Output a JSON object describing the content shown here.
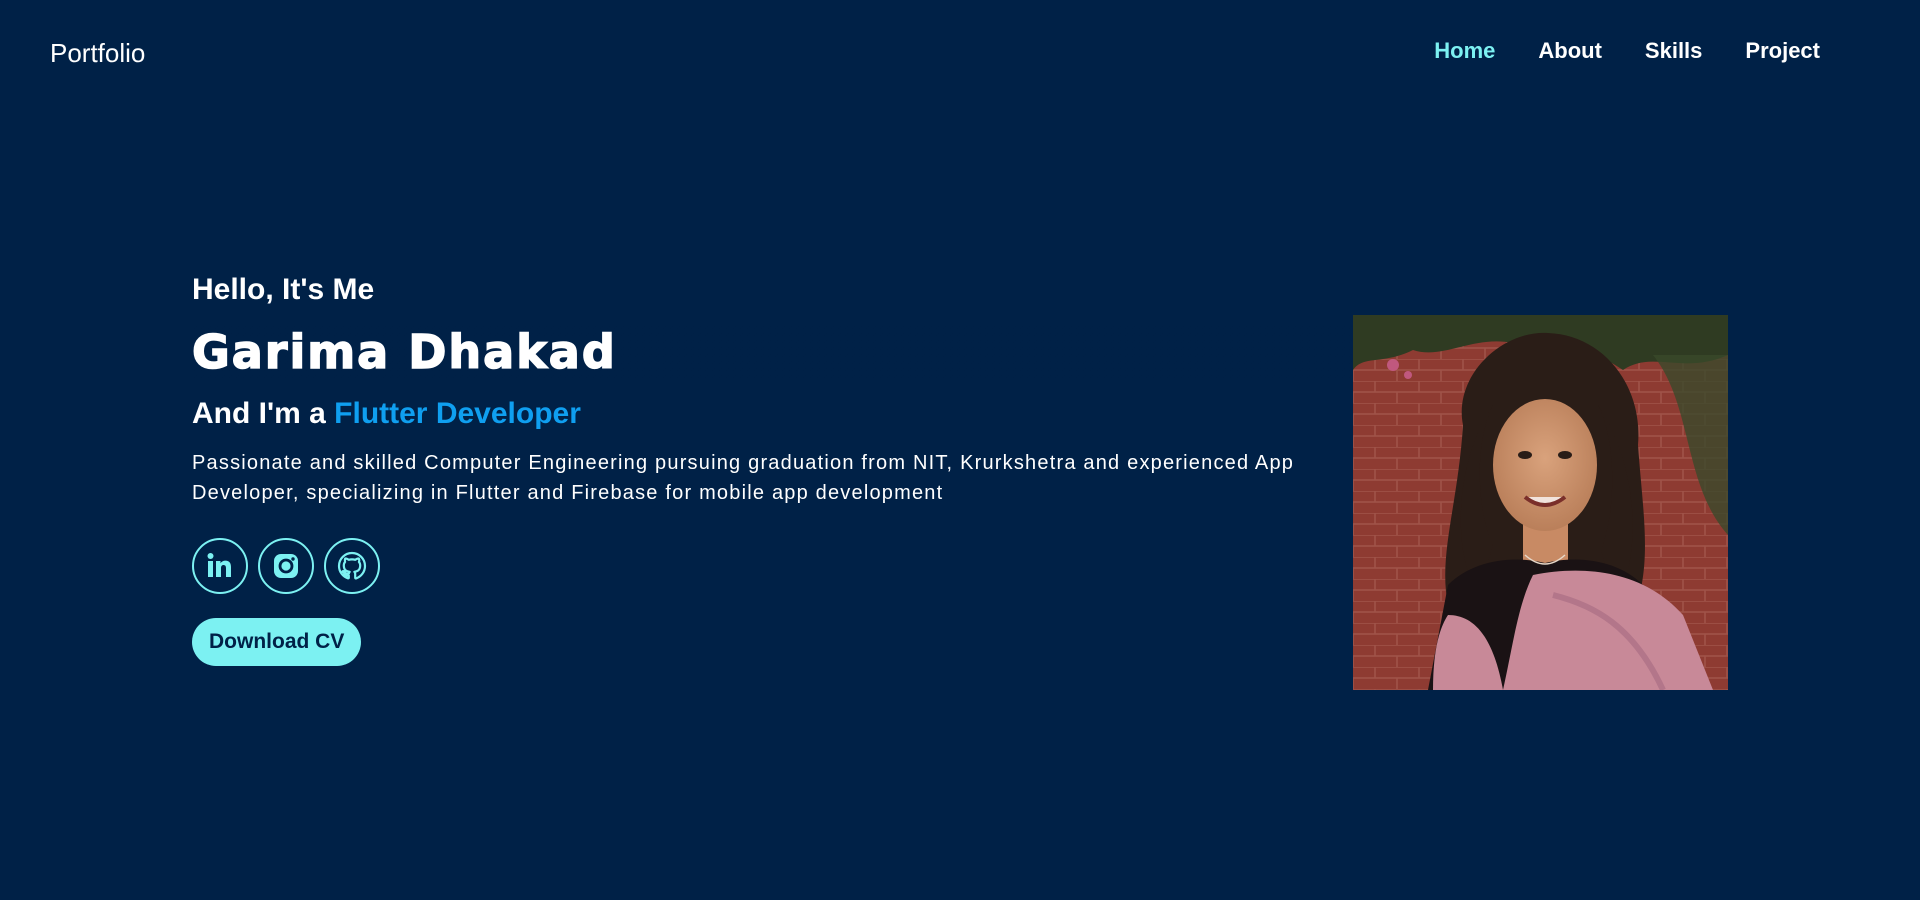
{
  "header": {
    "logo": "Portfolio",
    "nav": [
      {
        "label": "Home",
        "active": true
      },
      {
        "label": "About",
        "active": false
      },
      {
        "label": "Skills",
        "active": false
      },
      {
        "label": "Project",
        "active": false
      }
    ]
  },
  "hero": {
    "greeting": "Hello, It's Me",
    "name": "Garima Dhakad",
    "role_prefix": "And I'm a ",
    "role": "Flutter Developer",
    "description": "Passionate and skilled Computer Engineering pursuing graduation from NIT, Krurkshetra and experienced App Developer, specializing in Flutter and Firebase for mobile app development",
    "socials": [
      {
        "icon": "linkedin-icon"
      },
      {
        "icon": "instagram-icon"
      },
      {
        "icon": "github-icon"
      }
    ],
    "cv_button": "Download CV"
  },
  "colors": {
    "background": "#002147",
    "accent": "#7CF1F2",
    "role_accent": "#0F9FF0",
    "text": "#ffffff"
  }
}
